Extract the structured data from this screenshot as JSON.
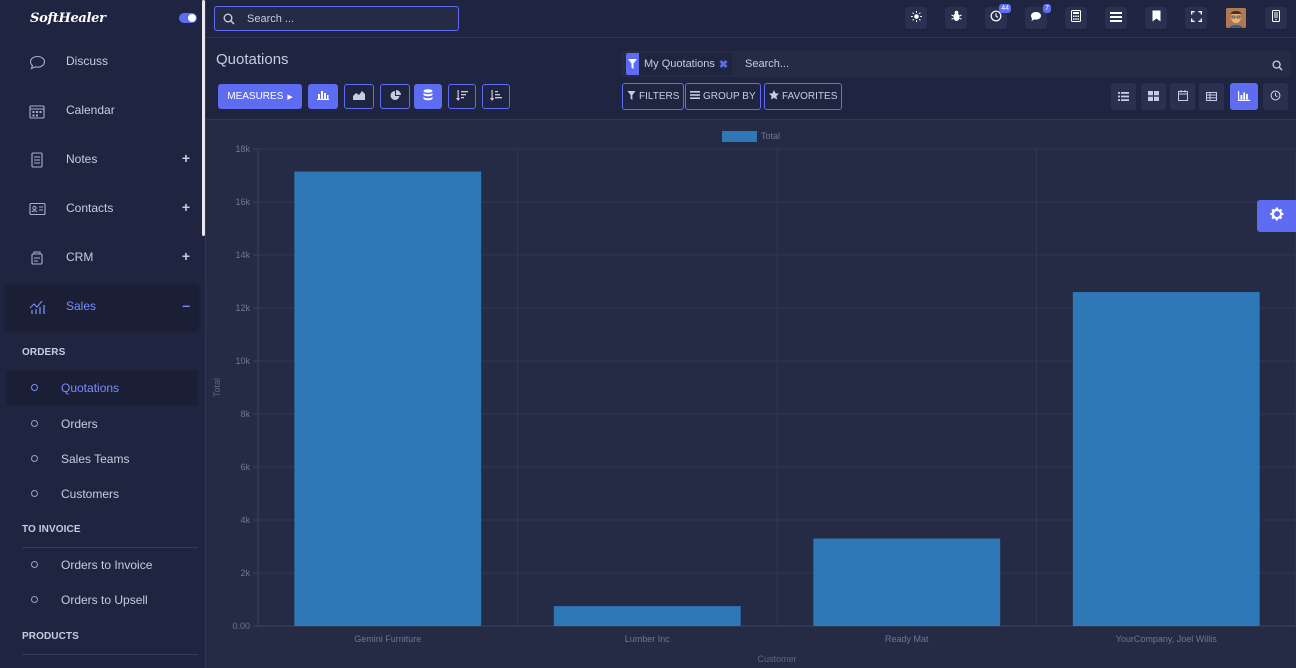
{
  "brand": {
    "logo_text": "SoftHealer"
  },
  "sidebar": {
    "apps": [
      {
        "label": "Discuss",
        "icon": "chat-bubble-icon",
        "expandable": false,
        "active": false
      },
      {
        "label": "Calendar",
        "icon": "calendar-icon",
        "expandable": false,
        "active": false
      },
      {
        "label": "Notes",
        "icon": "notes-icon",
        "expandable": true,
        "active": false
      },
      {
        "label": "Contacts",
        "icon": "contact-card-icon",
        "expandable": true,
        "active": false
      },
      {
        "label": "CRM",
        "icon": "crm-icon",
        "expandable": true,
        "active": false
      },
      {
        "label": "Sales",
        "icon": "sales-chart-icon",
        "expandable": true,
        "active": true
      }
    ],
    "sections": [
      {
        "title": "ORDERS",
        "items": [
          {
            "label": "Quotations",
            "active": true
          },
          {
            "label": "Orders"
          },
          {
            "label": "Sales Teams"
          },
          {
            "label": "Customers"
          }
        ]
      },
      {
        "title": "TO INVOICE",
        "items": [
          {
            "label": "Orders to Invoice"
          },
          {
            "label": "Orders to Upsell"
          }
        ]
      },
      {
        "title": "PRODUCTS",
        "items": []
      }
    ]
  },
  "topbar": {
    "search_placeholder": "Search ...",
    "activity_count": "44",
    "message_count": "7"
  },
  "control": {
    "title": "Quotations",
    "measures_label": "MEASURES",
    "facet_label": "My Quotations",
    "search_placeholder": "Search...",
    "filters_label": "FILTERS",
    "groupby_label": "GROUP BY",
    "favorites_label": "FAVORITES"
  },
  "colors": {
    "accent": "#5d6cf0",
    "bar": "#2e78b7",
    "bg": "#252b45",
    "panel": "#1f2540"
  },
  "chart_data": {
    "type": "bar",
    "categories": [
      "Gemini Furniture",
      "Lumber Inc",
      "Ready Mat",
      "YourCompany, Joel Willis"
    ],
    "series": [
      {
        "name": "Total",
        "values": [
          17150,
          750,
          3300,
          12600
        ]
      }
    ],
    "xlabel": "Customer",
    "ylabel": "Total",
    "ylim": [
      0,
      18000
    ],
    "yticks": [
      "0.00",
      "2k",
      "4k",
      "6k",
      "8k",
      "10k",
      "12k",
      "14k",
      "16k",
      "18k"
    ],
    "grid": true,
    "legend": "top-center"
  }
}
